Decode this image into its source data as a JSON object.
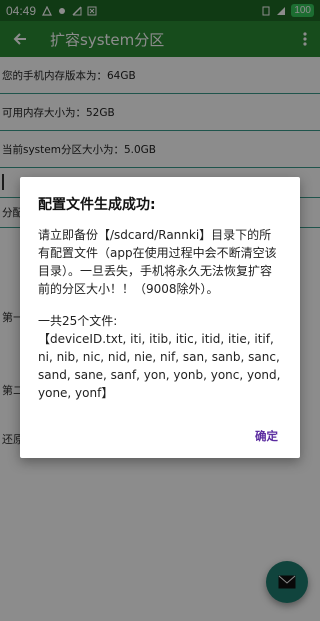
{
  "status_bar": {
    "time": "04:49",
    "battery": "100"
  },
  "app_bar": {
    "title": "扩容system分区"
  },
  "rows": {
    "memory": "您的手机内存版本为：64GB",
    "available": "可用内存大小为：52GB",
    "system_partition": "当前system分区大小为：5.0GB",
    "input_value": "",
    "partition_label": "分配"
  },
  "side_labels": {
    "first": "第一",
    "second": "第二",
    "restore": "还原"
  },
  "dialog": {
    "title": "配置文件生成成功:",
    "message": "请立即备份【/sdcard/Rannki】目录下的所有配置文件（app在使用过程中会不断清空该目录）。一旦丢失，手机将永久无法恢复扩容前的分区大小！！（9008除外）。",
    "files": "一共25个文件:\n【deviceID.txt, iti, itib, itic, itid, itie, itif, ni, nib, nic, nid, nie, nif, san, sanb, sanc, sand, sane, sanf, yon, yonb, yonc, yond, yone, yonf】",
    "ok_label": "确定"
  },
  "colors": {
    "primary": "#2a8a33",
    "primary_dark": "#1e6a26",
    "accent": "#1e7d6f",
    "dialog_button": "#5b2ca0"
  },
  "icons": {
    "back": "arrow-back-icon",
    "menu": "more-vert-icon",
    "fab": "email-icon"
  }
}
